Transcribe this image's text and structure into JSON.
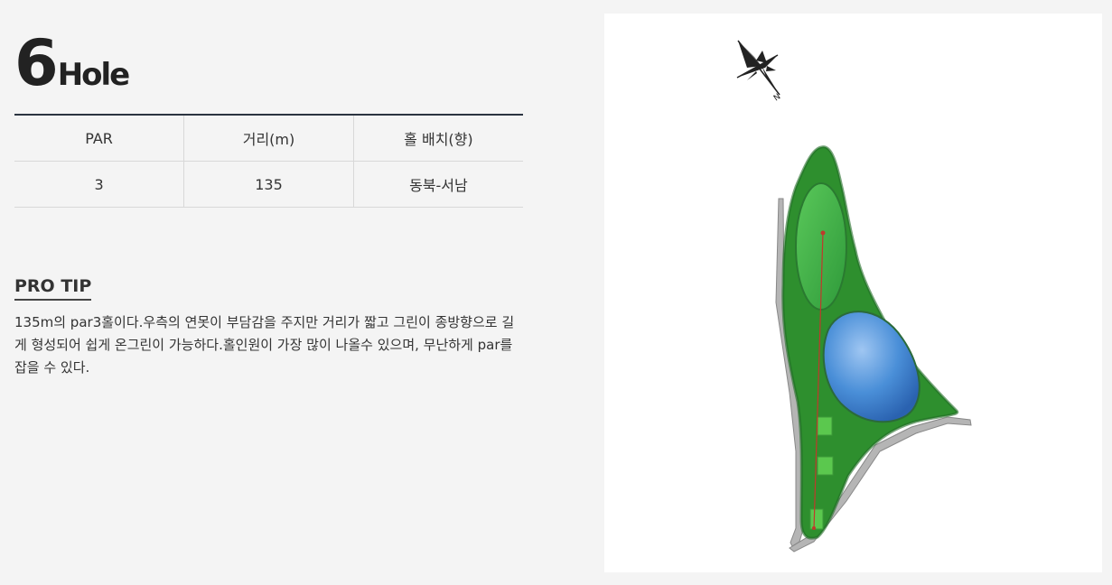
{
  "hole": {
    "number": "6",
    "label": "Hole"
  },
  "info_table": {
    "headers": [
      "PAR",
      "거리(m)",
      "홀 배치(향)"
    ],
    "row": [
      "3",
      "135",
      "동북-서남"
    ]
  },
  "pro_tip": {
    "title": "PRO TIP",
    "text": "135m의 par3홀이다.우측의 연못이 부담감을 주지만 거리가 짧고 그린이 종방향으로 길게 형성되어 쉽게 온그린이 가능하다.홀인원이 가장 많이 나올수 있으며, 무난하게 par를 잡을 수 있다."
  },
  "map": {
    "compass_letter": "N",
    "icon": "compass-rose-icon"
  },
  "colors": {
    "accent_line": "#2b3440",
    "background": "#f4f4f4",
    "fairway": "#2e8f2e",
    "water": "#4a8fd8",
    "shot_line": "#c0392b"
  }
}
